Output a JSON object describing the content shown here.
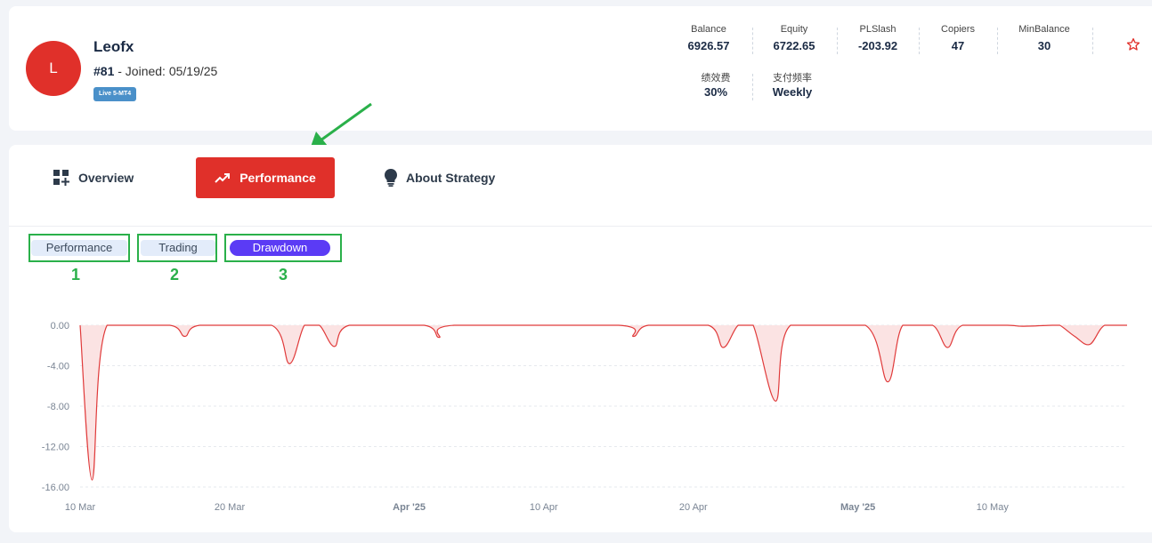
{
  "profile": {
    "avatar_letter": "L",
    "name": "Leofx",
    "rank": "#81",
    "joined": " - Joined: 05/19/25",
    "badge": "Live 5-MT4"
  },
  "stats": [
    {
      "label": "Balance",
      "value": "6926.57"
    },
    {
      "label": "Equity",
      "value": "6722.65"
    },
    {
      "label": "PLSlash",
      "value": "-203.92"
    },
    {
      "label": "Copiers",
      "value": "47"
    },
    {
      "label": "MinBalance",
      "value": "30"
    },
    {
      "label": "绩效费",
      "value": "30%"
    },
    {
      "label": "支付频率",
      "value": "Weekly"
    }
  ],
  "tabs": [
    {
      "label": "Overview",
      "icon": "dashboard-add-icon"
    },
    {
      "label": "Performance",
      "icon": "trending-up-icon",
      "active": true
    },
    {
      "label": "About Strategy",
      "icon": "lightbulb-icon"
    }
  ],
  "subtabs": [
    {
      "label": "Performance",
      "annotation": "1"
    },
    {
      "label": "Trading",
      "annotation": "2"
    },
    {
      "label": "Drawdown",
      "annotation": "3",
      "active": true
    }
  ],
  "colors": {
    "accent_red": "#e0302a",
    "active_pill": "#5b3bf5",
    "annotation_green": "#2ab04a",
    "line": "#e03a3a",
    "area_fill": "#fbe3e3"
  },
  "chart_data": {
    "type": "area",
    "title": "",
    "xlabel": "",
    "ylabel": "",
    "ylim": [
      -16,
      0
    ],
    "y_ticks": [
      "0.00",
      "-4.00",
      "-8.00",
      "-12.00",
      "-16.00"
    ],
    "x_ticks": [
      "10 Mar",
      "20 Mar",
      "Apr '25",
      "10 Apr",
      "20 Apr",
      "May '25",
      "10 May"
    ],
    "grid": true,
    "series": [
      {
        "values": [
          [
            0.0,
            0.0
          ],
          [
            0.8,
            -15.3
          ],
          [
            1.8,
            0.0
          ],
          [
            6.0,
            0.0
          ],
          [
            7.0,
            -1.1
          ],
          [
            8.0,
            0.0
          ],
          [
            12.8,
            0.0
          ],
          [
            14.0,
            -3.8
          ],
          [
            15.0,
            0.0
          ],
          [
            16.0,
            0.0
          ],
          [
            17.0,
            -2.1
          ],
          [
            18.0,
            0.0
          ],
          [
            23.0,
            0.0
          ],
          [
            24.0,
            -1.2
          ],
          [
            25.0,
            0.0
          ],
          [
            36.0,
            0.0
          ],
          [
            37.0,
            -1.1
          ],
          [
            38.0,
            0.0
          ],
          [
            42.0,
            0.0
          ],
          [
            43.0,
            -2.2
          ],
          [
            44.0,
            0.0
          ],
          [
            45.0,
            0.0
          ],
          [
            46.5,
            -7.5
          ],
          [
            47.5,
            0.0
          ],
          [
            52.5,
            0.0
          ],
          [
            54.0,
            -5.6
          ],
          [
            55.0,
            0.0
          ],
          [
            57.0,
            0.0
          ],
          [
            58.0,
            -2.2
          ],
          [
            59.0,
            0.0
          ],
          [
            62.0,
            0.0
          ],
          [
            63.0,
            -0.1
          ],
          [
            65.0,
            0.0
          ],
          [
            65.5,
            0.0
          ],
          [
            66.5,
            -1.1
          ],
          [
            67.5,
            -1.9
          ],
          [
            68.5,
            0.0
          ],
          [
            70.0,
            0.0
          ]
        ]
      }
    ]
  }
}
